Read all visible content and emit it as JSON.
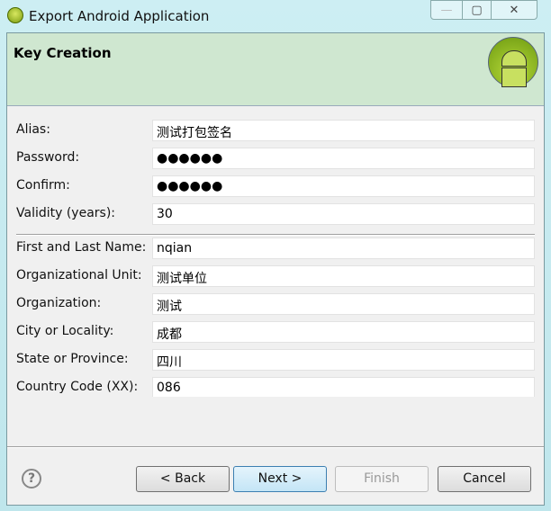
{
  "window": {
    "title": "Export Android Application",
    "minimize": "—",
    "maximize": "▢",
    "close": "✕"
  },
  "header": {
    "title": "Key Creation"
  },
  "form": {
    "group1": [
      {
        "label": "Alias:",
        "value": "测试打包签名"
      },
      {
        "label": "Password:",
        "value": "●●●●●●"
      },
      {
        "label": "Confirm:",
        "value": "●●●●●●"
      },
      {
        "label": "Validity (years):",
        "value": "30"
      }
    ],
    "group2": [
      {
        "label": "First and Last Name:",
        "value": "nqian"
      },
      {
        "label": "Organizational Unit:",
        "value": "测试单位"
      },
      {
        "label": "Organization:",
        "value": "测试"
      },
      {
        "label": "City or Locality:",
        "value": "成都"
      },
      {
        "label": "State or Province:",
        "value": "四川"
      },
      {
        "label": "Country Code (XX):",
        "value": "086"
      }
    ]
  },
  "buttons": {
    "help": "?",
    "back": "< Back",
    "next": "Next >",
    "finish": "Finish",
    "cancel": "Cancel"
  }
}
